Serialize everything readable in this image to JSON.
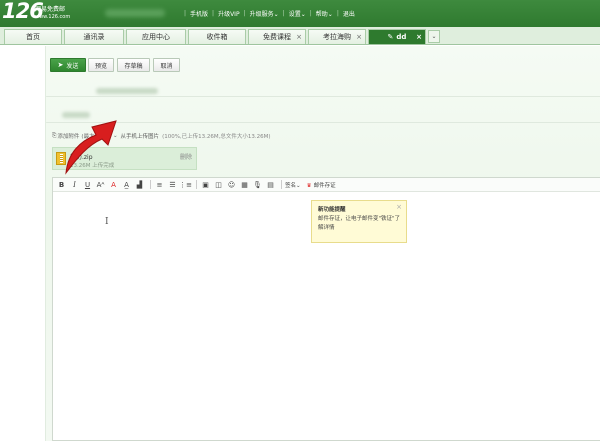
{
  "header": {
    "logo_number": "126",
    "logo_name": "网易免费邮",
    "logo_url": "www.126.com",
    "nav": [
      "手机版",
      "升级VIP",
      "升级服务",
      "设置",
      "帮助",
      "退出"
    ],
    "nav_dropdown_flags": [
      false,
      false,
      true,
      true,
      true,
      false
    ]
  },
  "tabs": {
    "items": [
      "首页",
      "通讯录",
      "应用中心",
      "收件箱",
      "免费课程",
      "考拉海购"
    ],
    "active": "dd"
  },
  "compose": {
    "send_label": "发送",
    "preview_label": "预览",
    "draft_label": "存草稿",
    "cancel_label": "取消",
    "attach_label": "添加附件",
    "attach_limit_prefix": "(最大",
    "attach_limit_value": "3G",
    "attach_limit_suffix": ")",
    "mobile_upload_label": "从手机上传图片",
    "quota_text": "(100%,已上传13.26M,总文件大小13.26M)"
  },
  "attachment": {
    "name": "简历.zip",
    "status": "13.26M 上传完成",
    "delete_label": "删除"
  },
  "toolbar": {
    "signature_label": "签名",
    "stamp_label": "邮件存证"
  },
  "tooltip": {
    "title": "新功能提醒",
    "body": "邮件存证，让电子邮件变\"铁证\"了解详情"
  },
  "colors": {
    "header_green": "#2f7a2f",
    "send_green": "#2e862e",
    "arrow_red": "#d81e1e"
  }
}
